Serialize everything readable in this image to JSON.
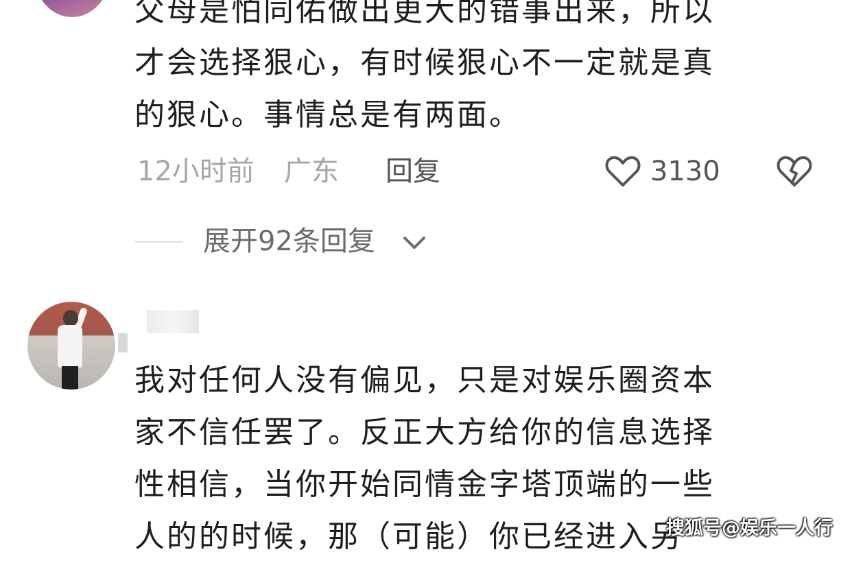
{
  "comment1": {
    "text_lines": [
      "父母是怕同佑做出更大的错事出来，所以",
      "才会选择狠心，有时候狠心不一定就是真",
      "的狠心。事情总是有两面。"
    ],
    "time": "12小时前",
    "location": "广东",
    "reply_label": "回复",
    "like_count": "3130",
    "like_icon": "heart-outline-icon",
    "dislike_icon": "broken-heart-icon"
  },
  "expand": {
    "label": "展开92条回复",
    "icon": "chevron-down-icon"
  },
  "comment2": {
    "text_lines": [
      "我对任何人没有偏见，只是对娱乐圈资本",
      "家不信任罢了。反正大方给你的信息选择",
      "性相信，当你开始同情金字塔顶端的一些",
      "人的的时候，那（可能）你已经进入另"
    ]
  },
  "watermark": "搜狐号@娱乐一人行",
  "colors": {
    "text": "#1e1e1e",
    "meta": "#a6a6a6",
    "action": "#555555",
    "background": "#ffffff"
  }
}
